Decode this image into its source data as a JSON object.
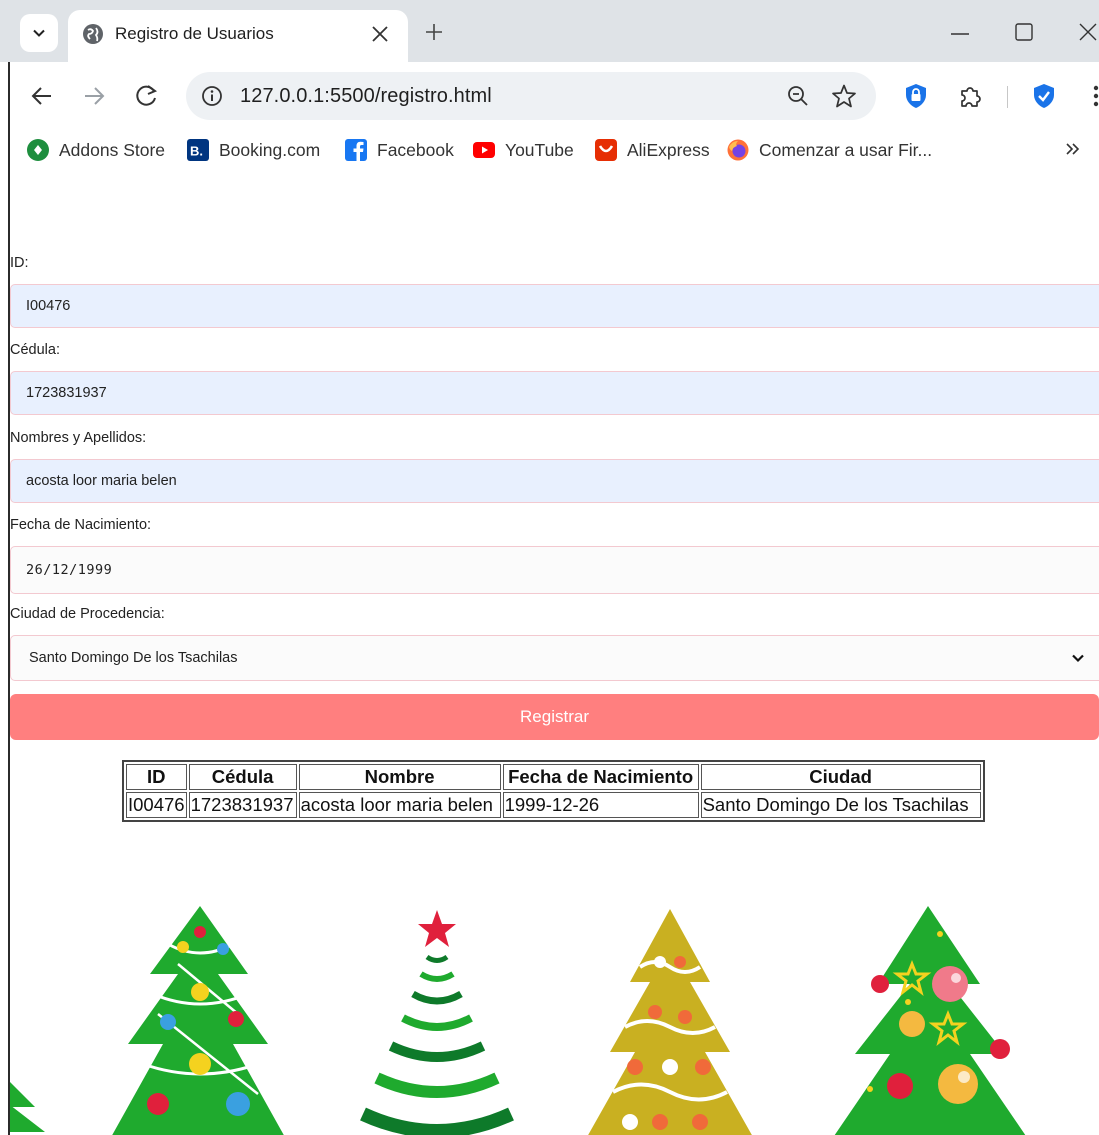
{
  "browser": {
    "tab_title": "Registro de Usuarios",
    "url": "127.0.0.1:5500/registro.html",
    "bookmarks": [
      {
        "label": "Addons Store",
        "icon": "addons-icon"
      },
      {
        "label": "Booking.com",
        "icon": "booking-icon"
      },
      {
        "label": "Facebook",
        "icon": "facebook-icon"
      },
      {
        "label": "YouTube",
        "icon": "youtube-icon"
      },
      {
        "label": "AliExpress",
        "icon": "aliexpress-icon"
      },
      {
        "label": "Comenzar a usar Fir...",
        "icon": "firefox-icon"
      }
    ],
    "booking_glyph": "B.",
    "colors": {
      "tabstrip": "#dfe3e7",
      "omnibox": "#eef1f4",
      "shield": "#1a73e8"
    }
  },
  "form": {
    "id_label": "ID:",
    "id_value": "I00476",
    "cedula_label": "Cédula:",
    "cedula_value": "1723831937",
    "nombres_label": "Nombres y Apellidos:",
    "nombres_value": "acosta loor maria belen",
    "fecha_label": "Fecha de Nacimiento:",
    "fecha_value": "26/12/1999",
    "ciudad_label": "Ciudad de Procedencia:",
    "ciudad_value": "Santo Domingo De los Tsachilas",
    "submit_label": "Registrar",
    "colors": {
      "button": "#ff7f7f",
      "autofill": "#e8f0fe",
      "border": "#f3c9d0"
    }
  },
  "table": {
    "headers": [
      "ID",
      "Cédula",
      "Nombre",
      "Fecha de Nacimiento",
      "Ciudad"
    ],
    "rows": [
      [
        "I00476",
        "1723831937",
        "acosta loor maria belen",
        "1999-12-26",
        "Santo Domingo De los Tsachilas"
      ]
    ]
  },
  "decoration": {
    "tree_colors": {
      "green": "#1faa2e",
      "dark_green": "#0e7a2a",
      "gold": "#c9b021",
      "red": "#e0203c"
    }
  }
}
